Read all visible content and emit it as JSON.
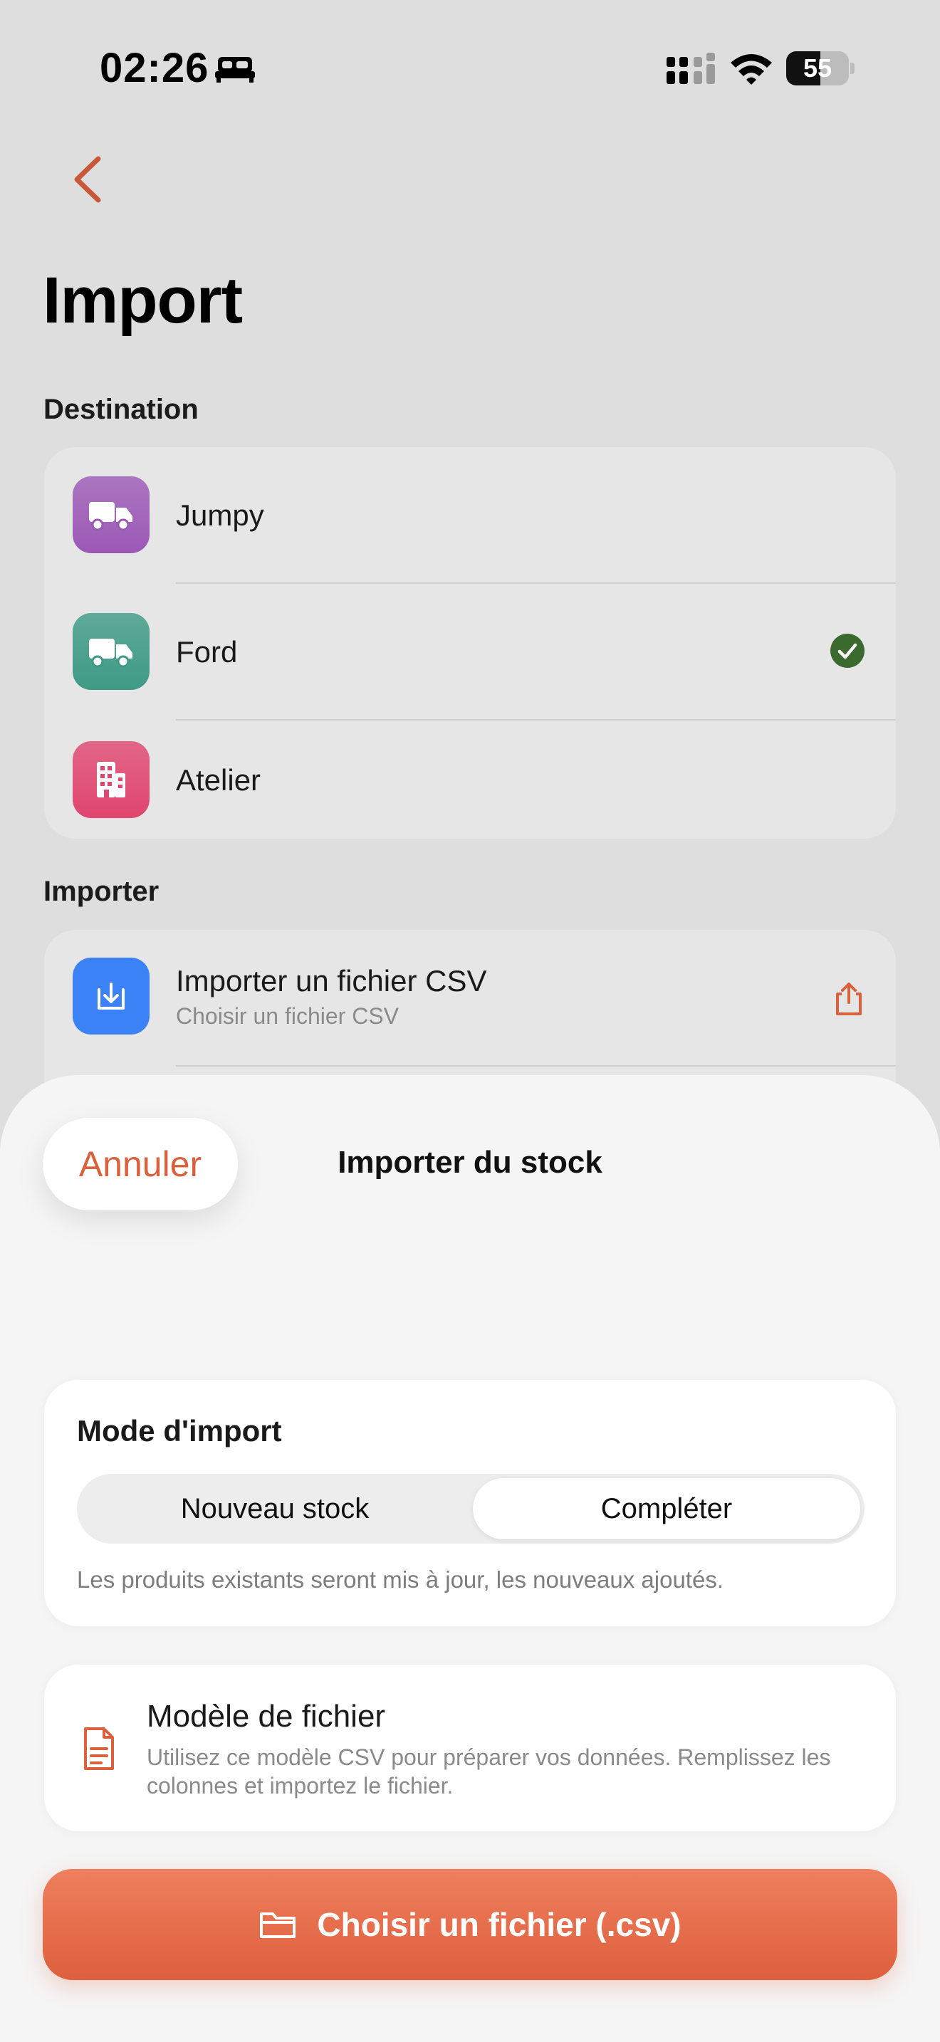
{
  "status": {
    "time": "02:26",
    "battery_level": "55",
    "battery_fraction": 0.55
  },
  "header": {
    "title": "Import"
  },
  "destination": {
    "section_title": "Destination",
    "items": [
      {
        "label": "Jumpy",
        "icon": "truck-icon",
        "color": "#9b59b6",
        "selected": false
      },
      {
        "label": "Ford",
        "icon": "truck-icon",
        "color": "#3e9a86",
        "selected": true
      },
      {
        "label": "Atelier",
        "icon": "building-icon",
        "color": "#e0466f",
        "selected": false
      }
    ],
    "check_color": "#3a6a2e"
  },
  "importer": {
    "section_title": "Importer",
    "csv_label": "Importer un fichier CSV",
    "csv_sub": "Choisir un fichier CSV",
    "icon_color": "#3b82f6"
  },
  "sheet": {
    "cancel_label": "Annuler",
    "title": "Importer du stock",
    "mode": {
      "title": "Mode d'import",
      "options": [
        "Nouveau stock",
        "Compléter"
      ],
      "selected": "Compléter",
      "note": "Les produits existants seront mis à jour, les nouveaux ajoutés."
    },
    "template": {
      "title": "Modèle de fichier",
      "description": "Utilisez ce modèle CSV pour préparer vos données. Remplissez les colonnes et importez le fichier."
    },
    "choose_label": "Choisir un fichier (.csv)"
  },
  "accent_color": "#d9613d"
}
